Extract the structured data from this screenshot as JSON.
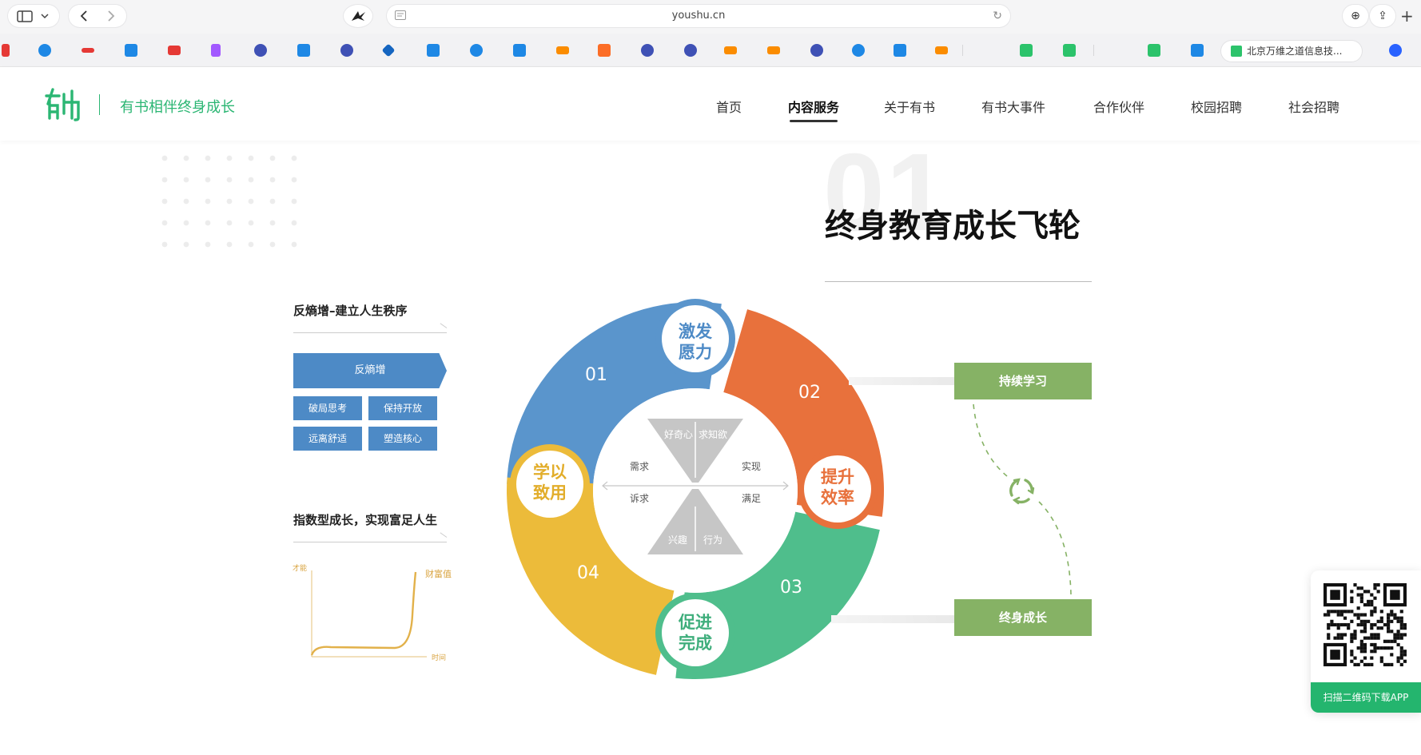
{
  "browser": {
    "url": "youshu.cn",
    "active_tab_title": "北京万维之道信息技..."
  },
  "site": {
    "slogan": "有书相伴终身成长",
    "nav": [
      {
        "label": "首页"
      },
      {
        "label": "内容服务"
      },
      {
        "label": "关于有书"
      },
      {
        "label": "有书大事件"
      },
      {
        "label": "合作伙伴"
      },
      {
        "label": "校园招聘"
      },
      {
        "label": "社会招聘"
      }
    ],
    "active_nav": "内容服务"
  },
  "section": {
    "number": "01",
    "title": "终身教育成长飞轮"
  },
  "entropy_block": {
    "heading": "反熵增–建立人生秩序",
    "banner": "反熵增",
    "chips": [
      "破局思考",
      "保持开放",
      "远离舒适",
      "塑造核心"
    ]
  },
  "growth_block": {
    "heading": "指数型成长，实现富足人生",
    "y_label": "才能",
    "curve_label": "财富值",
    "x_label": "时间"
  },
  "wheel": {
    "segments": [
      {
        "num": "01",
        "label_line1": "激发",
        "label_line2": "愿力",
        "color": "#5a95cc"
      },
      {
        "num": "02",
        "label_line1": "提升",
        "label_line2": "效率",
        "color": "#e8713c"
      },
      {
        "num": "03",
        "label_line1": "促进",
        "label_line2": "完成",
        "color": "#4fbe8c"
      },
      {
        "num": "04",
        "label_line1": "学以",
        "label_line2": "致用",
        "color": "#ecbb3a"
      }
    ],
    "hourglass": {
      "top_left": "好奇心",
      "top_right": "求知欲",
      "mid_left_1": "需求",
      "mid_right_1": "实现",
      "mid_left_2": "诉求",
      "mid_right_2": "满足",
      "bottom_left": "兴趣",
      "bottom_right": "行为"
    }
  },
  "loop": {
    "top_box": "持续学习",
    "bottom_box": "终身成长",
    "accent": "#86b265"
  },
  "qr_widget": {
    "caption": "扫描二维码下载APP"
  }
}
